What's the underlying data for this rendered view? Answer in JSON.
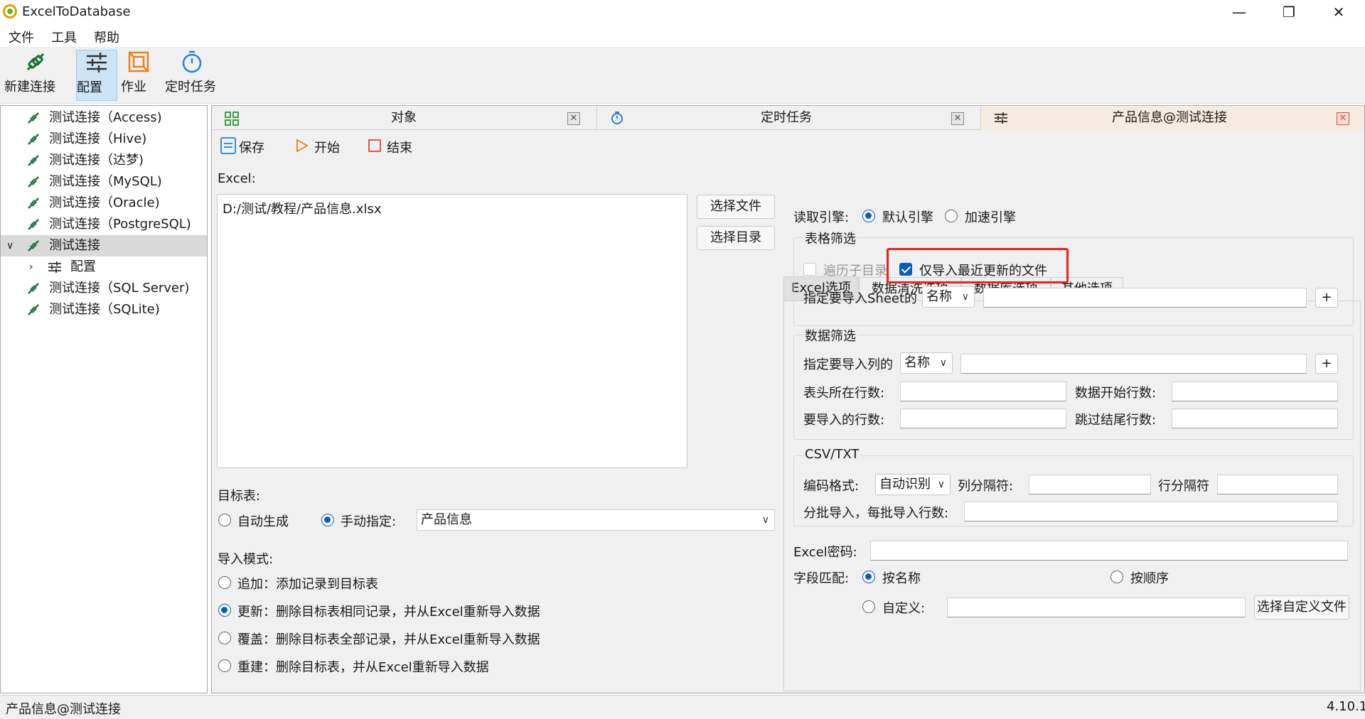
{
  "window": {
    "title": "ExcelToDatabase"
  },
  "menu": [
    "文件",
    "工具",
    "帮助"
  ],
  "toolbar": {
    "new_connection": "新建连接",
    "config": "配置",
    "job": "作业",
    "scheduled": "定时任务"
  },
  "tree": {
    "items": [
      "测试连接（Access)",
      "测试连接（Hive)",
      "测试连接（达梦)",
      "测试连接（MySQL)",
      "测试连接（Oracle)",
      "测试连接（PostgreSQL)",
      "测试连接",
      "配置",
      "测试连接（SQL Server)",
      "测试连接（SQLite)"
    ]
  },
  "tabs": [
    "对象",
    "定时任务",
    "产品信息@测试连接"
  ],
  "subtoolbar": {
    "save": "保存",
    "start": "开始",
    "stop": "结束"
  },
  "excel": {
    "label": "Excel:",
    "path": "D:/测试/教程/产品信息.xlsx",
    "select_file": "选择文件",
    "select_dir": "选择目录"
  },
  "target": {
    "label": "目标表:",
    "auto": "自动生成",
    "manual": "手动指定:",
    "value": "产品信息"
  },
  "import_mode": {
    "label": "导入模式:",
    "options": [
      "追加：添加记录到目标表",
      "更新：删除目标表相同记录，并从Excel重新导入数据",
      "覆盖：删除目标表全部记录，并从Excel重新导入数据",
      "重建：删除目标表，并从Excel重新导入数据"
    ],
    "selected_index": 1
  },
  "right_tabs": [
    "Excel选项",
    "数据清洗选项",
    "数据库选项",
    "其他选项"
  ],
  "engine": {
    "label": "读取引擎:",
    "default": "默认引擎",
    "fast": "加速引擎"
  },
  "table_filter": {
    "title": "表格筛选",
    "traverse": "遍历子目录",
    "only_recent": "仅导入最近更新的文件",
    "sheet_label": "指定要导入Sheet的",
    "sheet_mode": "名称",
    "add": "+"
  },
  "data_filter": {
    "title": "数据筛选",
    "col_label": "指定要导入列的",
    "col_mode": "名称",
    "add": "+",
    "header_row": "表头所在行数:",
    "data_start_row": "数据开始行数:",
    "import_rows": "要导入的行数:",
    "skip_tail_rows": "跳过结尾行数:"
  },
  "csv": {
    "title": "CSV/TXT",
    "encoding_label": "编码格式:",
    "encoding_value": "自动识别",
    "col_sep": "列分隔符:",
    "row_sep": "行分隔符",
    "batch": "分批导入，每批导入行数:"
  },
  "excel_password": "Excel密码:",
  "field_match": {
    "label": "字段匹配:",
    "by_name": "按名称",
    "by_order": "按顺序",
    "custom": "自定义:",
    "select_custom": "选择自定义文件"
  },
  "status": {
    "left": "产品信息@测试连接",
    "version": "4.10.1"
  },
  "colors": {
    "accent": "#0a5cc2",
    "highlight": "#e8231a",
    "connection_icon": "#1f6f3a"
  }
}
